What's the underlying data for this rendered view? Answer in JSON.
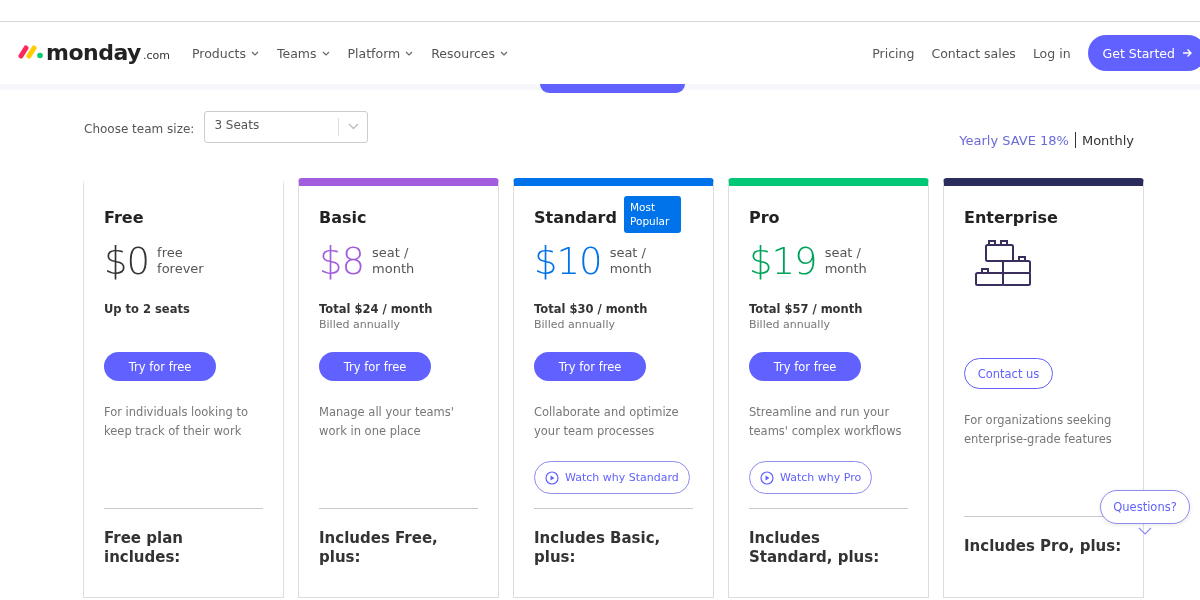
{
  "header": {
    "logo": {
      "name": "monday",
      "suffix": ".com"
    },
    "nav": [
      {
        "label": "Products",
        "dropdown": true
      },
      {
        "label": "Teams",
        "dropdown": true
      },
      {
        "label": "Platform",
        "dropdown": true
      },
      {
        "label": "Resources",
        "dropdown": true
      }
    ],
    "links": [
      "Pricing",
      "Contact sales",
      "Log in"
    ],
    "cta": "Get Started"
  },
  "team_size": {
    "label": "Choose team size:",
    "value": "3 Seats"
  },
  "billing": [
    {
      "label": "Yearly SAVE 18%",
      "selected": true
    },
    {
      "label": "Monthly",
      "selected": false
    }
  ],
  "plans": [
    {
      "kind": "price",
      "name": "Free",
      "color": "#ffffff",
      "price": {
        "text": "$0",
        "color": "#333333"
      },
      "unit": "free forever",
      "total": "Up to 2 seats",
      "button": "Try for free",
      "description": "For individuals looking to keep track of their work",
      "includes": "Free plan includes:"
    },
    {
      "kind": "price",
      "name": "Basic",
      "color": "#a25ddc",
      "price": {
        "text": "$8",
        "color": "#a25ddc"
      },
      "unit": "seat / month",
      "total": "Total $24 / month",
      "billed": "Billed annually",
      "button": "Try for free",
      "description": "Manage all your teams' work in one place",
      "includes": "Includes Free, plus:"
    },
    {
      "kind": "price",
      "name": "Standard",
      "color": "#0073ea",
      "badge": "Most Popular",
      "price": {
        "text": "$10",
        "color": "#0073ea"
      },
      "unit": "seat / month",
      "total": "Total $30 / month",
      "billed": "Billed annually",
      "button": "Try for free",
      "description": "Collaborate and optimize your team processes",
      "watch": "Watch why Standard",
      "includes": "Includes Basic, plus:"
    },
    {
      "kind": "price",
      "name": "Pro",
      "color": "#00c875",
      "price": {
        "text": "$19",
        "color": "#00a35c"
      },
      "unit": "seat / month",
      "total": "Total $57 / month",
      "billed": "Billed annually",
      "button": "Try for free",
      "description": "Streamline and run your teams' complex workflows",
      "watch": "Watch why Pro",
      "includes": "Includes Standard, plus:"
    },
    {
      "kind": "contact",
      "name": "Enterprise",
      "color": "#2b2c5c",
      "button": "Contact us",
      "description": "For organizations seeking enterprise-grade features",
      "includes": "Includes Pro, plus:"
    }
  ],
  "help": "Questions?"
}
